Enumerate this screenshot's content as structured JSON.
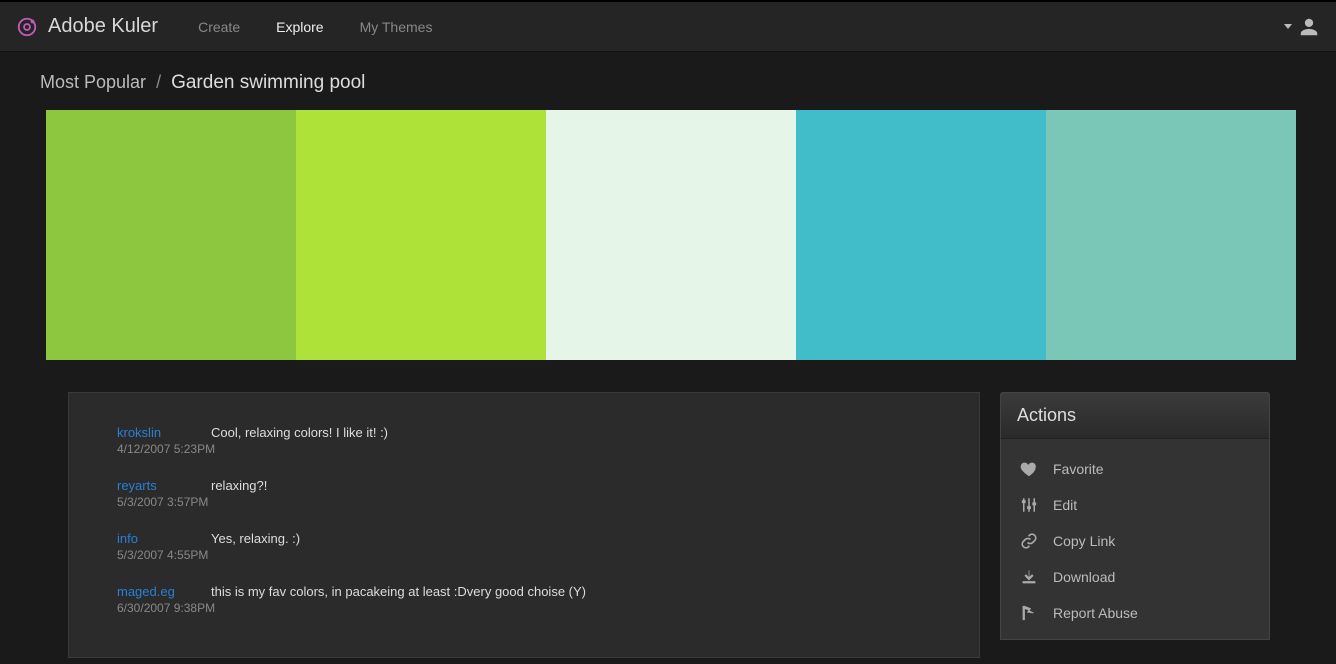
{
  "header": {
    "brand": "Adobe Kuler",
    "nav": [
      {
        "label": "Create",
        "active": false
      },
      {
        "label": "Explore",
        "active": true
      },
      {
        "label": "My Themes",
        "active": false
      }
    ]
  },
  "breadcrumb": {
    "category": "Most Popular",
    "separator": "/",
    "title": "Garden swimming pool"
  },
  "palette": {
    "colors": [
      "#8dc63f",
      "#aee239",
      "#e5f5e8",
      "#40bdc8",
      "#7ac7b8"
    ]
  },
  "comments": [
    {
      "author": "krokslin",
      "text": "Cool, relaxing colors! I like it! :)",
      "timestamp": "4/12/2007 5:23PM"
    },
    {
      "author": "reyarts",
      "text": "relaxing?!",
      "timestamp": "5/3/2007 3:57PM"
    },
    {
      "author": "info",
      "text": "Yes, relaxing. :)",
      "timestamp": "5/3/2007 4:55PM"
    },
    {
      "author": "maged.eg",
      "text": "this is my fav colors, in pacakeing at least :Dvery good choise (Y)",
      "timestamp": "6/30/2007 9:38PM"
    }
  ],
  "actions": {
    "title": "Actions",
    "items": [
      {
        "icon": "heart-icon",
        "label": "Favorite"
      },
      {
        "icon": "sliders-icon",
        "label": "Edit"
      },
      {
        "icon": "link-icon",
        "label": "Copy Link"
      },
      {
        "icon": "download-icon",
        "label": "Download"
      },
      {
        "icon": "flag-icon",
        "label": "Report Abuse"
      }
    ]
  }
}
